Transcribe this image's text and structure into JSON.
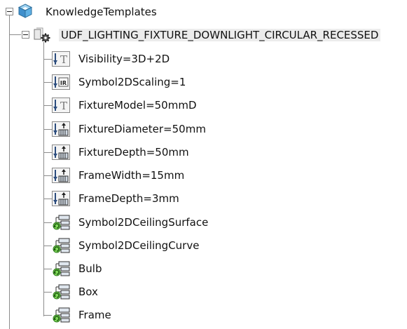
{
  "tree": {
    "root": {
      "label": "KnowledgeTemplates",
      "icon": "knowledge-templates-icon"
    },
    "udf": {
      "label": "UDF_LIGHTING_FIXTURE_DOWNLIGHT_CIRCULAR_RECESSED",
      "icon": "udf-gear-icon"
    },
    "children": [
      {
        "label": "Visibility=3D+2D",
        "icon": "text-parameter-icon"
      },
      {
        "label": "Symbol2DScaling=1",
        "icon": "real-parameter-icon"
      },
      {
        "label": "FixtureModel=50mmD",
        "icon": "text-parameter-icon"
      },
      {
        "label": "FixtureDiameter=50mm",
        "icon": "length-parameter-icon"
      },
      {
        "label": "FixtureDepth=50mm",
        "icon": "length-parameter-icon"
      },
      {
        "label": "FrameWidth=15mm",
        "icon": "length-parameter-icon"
      },
      {
        "label": "FrameDepth=3mm",
        "icon": "length-parameter-icon"
      },
      {
        "label": "Symbol2DCeilingSurface",
        "icon": "geometry-input-icon"
      },
      {
        "label": "Symbol2DCeilingCurve",
        "icon": "geometry-input-icon"
      },
      {
        "label": "Bulb",
        "icon": "geometry-input-icon"
      },
      {
        "label": "Box",
        "icon": "geometry-input-icon"
      },
      {
        "label": "Frame",
        "icon": "geometry-input-icon"
      }
    ]
  }
}
